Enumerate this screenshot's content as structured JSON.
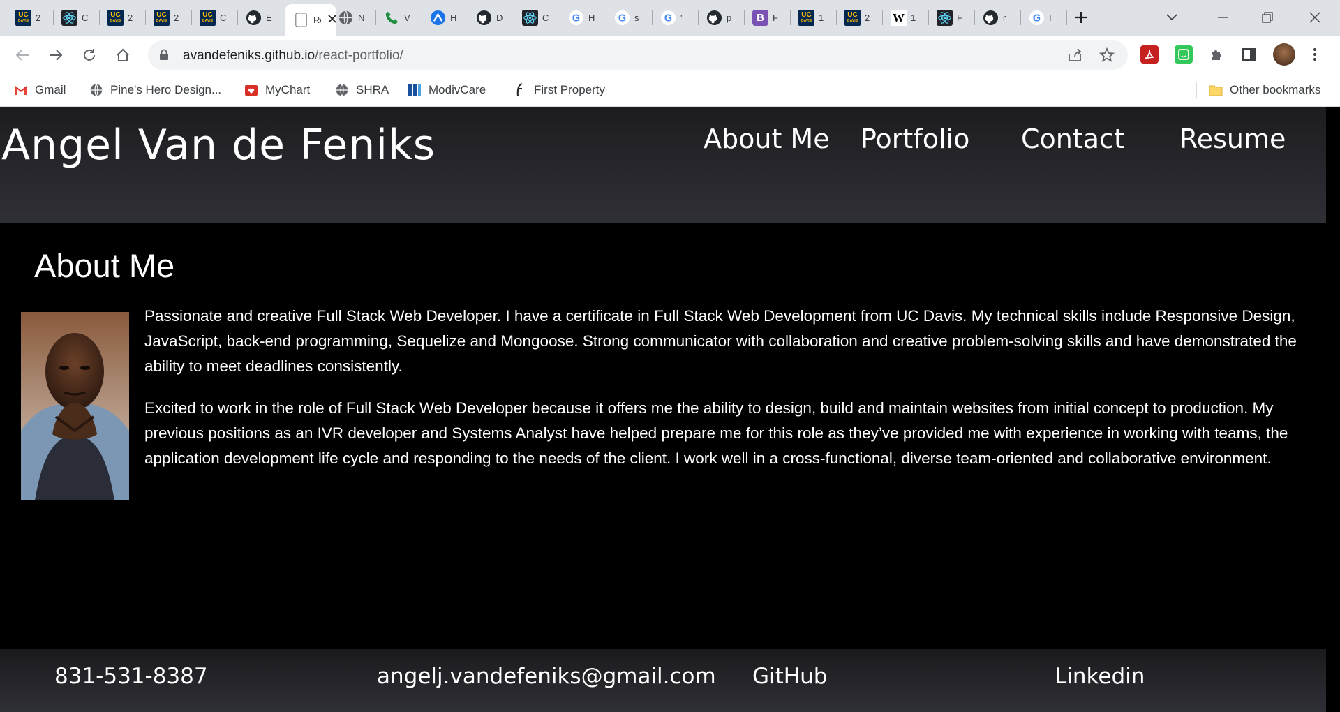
{
  "browser": {
    "tabs": [
      {
        "icon": "ucdavis-icon",
        "title": "2"
      },
      {
        "icon": "react-icon",
        "title": "C"
      },
      {
        "icon": "ucdavis-icon",
        "title": "2"
      },
      {
        "icon": "ucdavis-icon",
        "title": "2"
      },
      {
        "icon": "ucdavis-icon",
        "title": "C"
      },
      {
        "icon": "github-icon",
        "title": "E"
      },
      {
        "icon": "page-icon",
        "title": "Re",
        "active": true
      },
      {
        "icon": "globe-icon",
        "title": "N"
      },
      {
        "icon": "phone-icon",
        "title": "V"
      },
      {
        "icon": "app-icon",
        "title": "H"
      },
      {
        "icon": "github-icon",
        "title": "D"
      },
      {
        "icon": "react-icon",
        "title": "C"
      },
      {
        "icon": "google-icon",
        "title": "H"
      },
      {
        "icon": "google-icon",
        "title": "s"
      },
      {
        "icon": "google-icon",
        "title": "'"
      },
      {
        "icon": "github-icon",
        "title": "p"
      },
      {
        "icon": "bootstrap-icon",
        "title": "F"
      },
      {
        "icon": "ucdavis-icon",
        "title": "1"
      },
      {
        "icon": "ucdavis-icon",
        "title": "2"
      },
      {
        "icon": "wikipedia-icon",
        "title": "1"
      },
      {
        "icon": "react-icon",
        "title": "F"
      },
      {
        "icon": "github-icon",
        "title": "r"
      },
      {
        "icon": "google-icon",
        "title": "I"
      }
    ],
    "ucdavis_mark": "UC",
    "ucdavis_sub": "DAVIS",
    "bootstrap_mark": "B",
    "wikipedia_mark": "W",
    "google_mark": "G",
    "url_host": "avandefeniks.github.io",
    "url_path": "/react-portfolio/",
    "bookmarks": [
      {
        "icon": "gmail-icon",
        "label": "Gmail"
      },
      {
        "icon": "globe-icon",
        "label": "Pine's Hero Design..."
      },
      {
        "icon": "mychart-icon",
        "label": "MyChart"
      },
      {
        "icon": "globe-icon",
        "label": "SHRA"
      },
      {
        "icon": "modivcare-icon",
        "label": "ModivCare"
      },
      {
        "icon": "firstproperty-icon",
        "label": "First Property"
      }
    ],
    "other_bookmarks": "Other bookmarks",
    "colors": {
      "tabstrip": "#dee1e6",
      "omnibox": "#f1f3f4"
    }
  },
  "site": {
    "name": "Angel Van de Feniks",
    "nav": [
      "About Me",
      "Portfolio",
      "Contact",
      "Resume"
    ],
    "section_title": "About Me",
    "bio": [
      "Passionate and creative Full Stack Web Developer. I have a certificate in Full Stack Web Development from UC Davis. My technical skills include Responsive Design, JavaScript, back-end programming, Sequelize and Mongoose. Strong communicator with collaboration and creative problem-solving skills and have demonstrated the ability to meet deadlines consistently.",
      "Excited to work in the role of Full Stack Web Developer because it offers me the ability to design, build and maintain websites from initial concept to production. My previous positions as an IVR developer and Systems Analyst have helped prepare me for this role as they’ve provided me with experience in working with teams, the application development life cycle and responding to the needs of the client. I work well in a cross-functional, diverse team-oriented and collaborative environment."
    ],
    "footer": {
      "phone": "831-531-8387",
      "email": "angelj.vandefeniks@gmail.com",
      "github": "GitHub",
      "linkedin": "Linkedin"
    }
  }
}
